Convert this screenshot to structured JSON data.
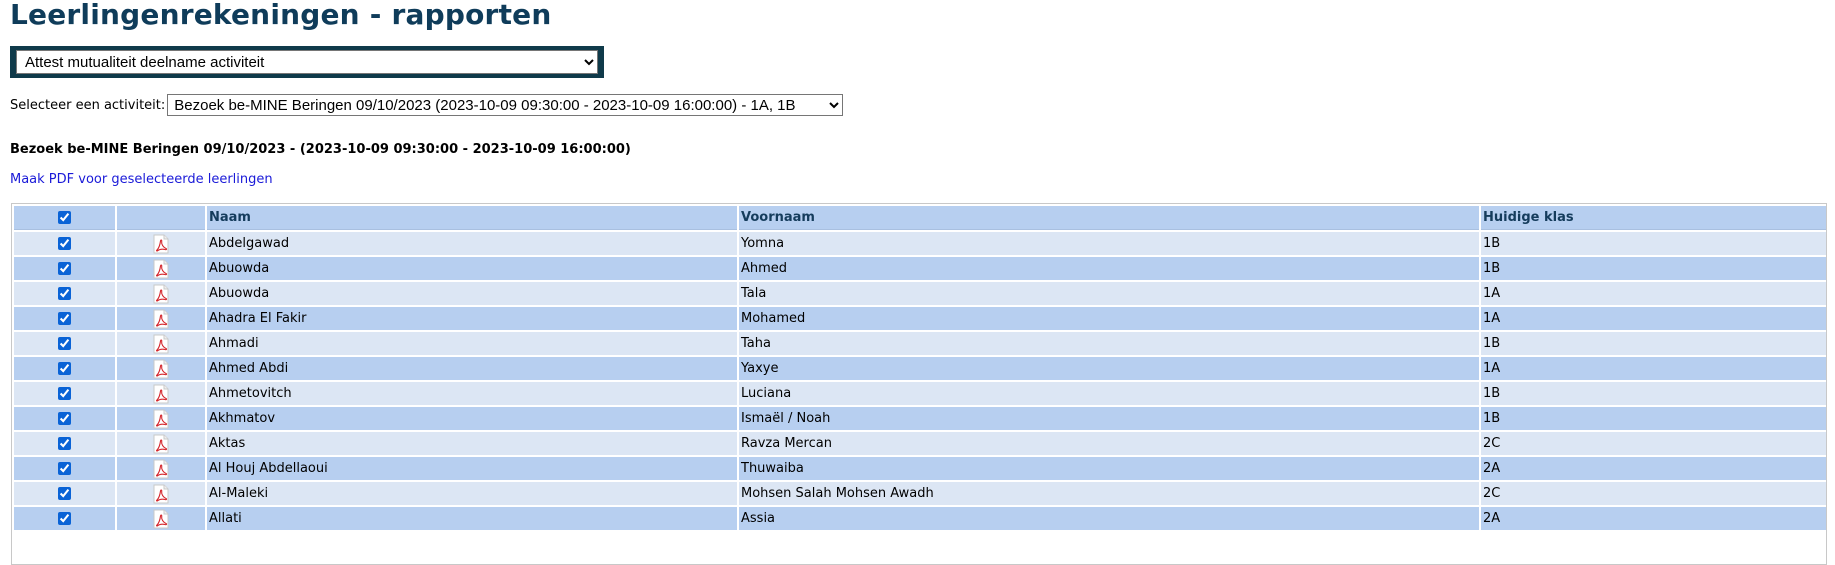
{
  "page": {
    "title": "Leerlingenrekeningen - rapporten"
  },
  "report_select": {
    "value": "Attest mutualiteit deelname activiteit"
  },
  "activity": {
    "label": "Selecteer een activiteit:",
    "selected": "Bezoek be-MINE Beringen 09/10/2023 (2023-10-09 09:30:00 - 2023-10-09 16:00:00) - 1A, 1B"
  },
  "activity_title": "Bezoek be-MINE Beringen 09/10/2023 - (2023-10-09 09:30:00 - 2023-10-09 16:00:00)",
  "pdf_link": "Maak PDF voor geselecteerde leerlingen",
  "table": {
    "headers": {
      "naam": "Naam",
      "voornaam": "Voornaam",
      "klas": "Huidige klas"
    },
    "header_checked": true,
    "rows": [
      {
        "checked": true,
        "icon": "pdf-icon",
        "naam": "Abdelgawad",
        "voornaam": "Yomna",
        "klas": "1B"
      },
      {
        "checked": true,
        "icon": "pdf-icon",
        "naam": "Abuowda",
        "voornaam": "Ahmed",
        "klas": "1B"
      },
      {
        "checked": true,
        "icon": "pdf-icon",
        "naam": "Abuowda",
        "voornaam": "Tala",
        "klas": "1A"
      },
      {
        "checked": true,
        "icon": "pdf-icon",
        "naam": "Ahadra El Fakir",
        "voornaam": "Mohamed",
        "klas": "1A"
      },
      {
        "checked": true,
        "icon": "pdf-icon",
        "naam": "Ahmadi",
        "voornaam": "Taha",
        "klas": "1B"
      },
      {
        "checked": true,
        "icon": "pdf-icon",
        "naam": "Ahmed Abdi",
        "voornaam": "Yaxye",
        "klas": "1A"
      },
      {
        "checked": true,
        "icon": "pdf-icon",
        "naam": "Ahmetovitch",
        "voornaam": "Luciana",
        "klas": "1B"
      },
      {
        "checked": true,
        "icon": "pdf-icon",
        "naam": "Akhmatov",
        "voornaam": "Ismaël / Noah",
        "klas": "1B"
      },
      {
        "checked": true,
        "icon": "pdf-icon",
        "naam": "Aktas",
        "voornaam": "Ravza Mercan",
        "klas": "2C"
      },
      {
        "checked": true,
        "icon": "pdf-icon",
        "naam": "Al Houj Abdellaoui",
        "voornaam": "Thuwaiba",
        "klas": "2A"
      },
      {
        "checked": true,
        "icon": "pdf-icon",
        "naam": "Al-Maleki",
        "voornaam": "Mohsen Salah Mohsen Awadh",
        "klas": "2C"
      },
      {
        "checked": true,
        "icon": "pdf-icon",
        "naam": "Allati",
        "voornaam": "Assia",
        "klas": "2A"
      }
    ]
  },
  "colors": {
    "title": "#0f3c5a",
    "row_light": "#dce6f4",
    "row_dark": "#b7cff0",
    "link": "#1a1ad8"
  }
}
